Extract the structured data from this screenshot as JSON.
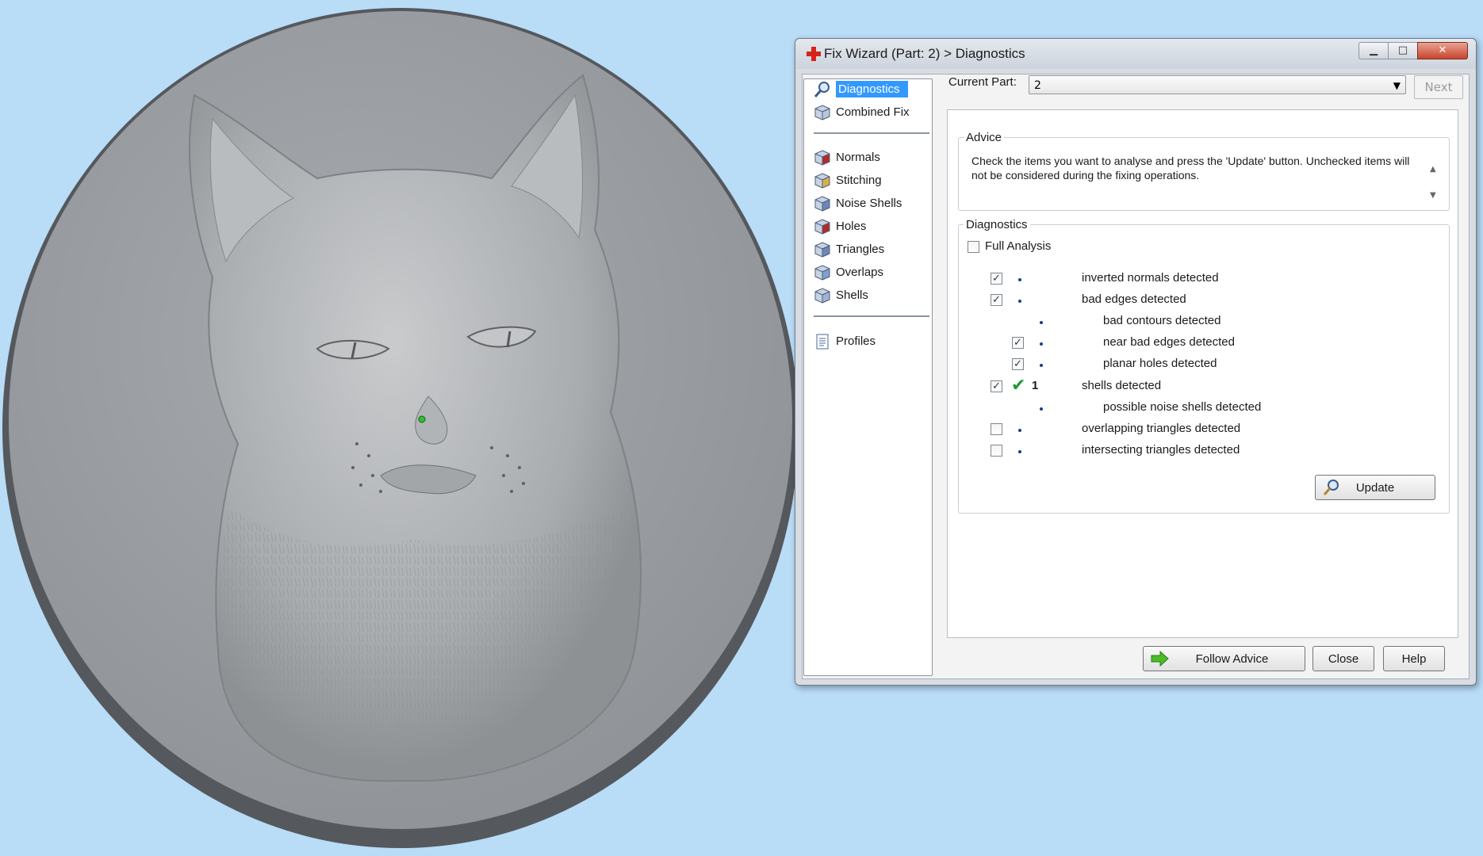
{
  "dialog": {
    "title": "Fix Wizard (Part: 2) > Diagnostics",
    "window_buttons": {
      "minimize": "▁",
      "maximize": "□",
      "close": "✕"
    }
  },
  "sidebar": {
    "items": [
      {
        "label": "Diagnostics",
        "icon": "magnifier-icon",
        "selected": true
      },
      {
        "label": "Combined Fix",
        "icon": "combined-fix-icon"
      },
      {
        "label": "Normals",
        "icon": "normals-cube-icon"
      },
      {
        "label": "Stitching",
        "icon": "stitching-cube-icon"
      },
      {
        "label": "Noise Shells",
        "icon": "noise-shells-icon"
      },
      {
        "label": "Holes",
        "icon": "holes-cube-icon"
      },
      {
        "label": "Triangles",
        "icon": "triangles-cube-icon"
      },
      {
        "label": "Overlaps",
        "icon": "overlaps-cube-icon"
      },
      {
        "label": "Shells",
        "icon": "shells-cube-icon"
      },
      {
        "label": "Profiles",
        "icon": "profiles-document-icon"
      }
    ]
  },
  "part": {
    "label": "Current Part:",
    "value": "2",
    "next_label": "Next"
  },
  "advice": {
    "legend": "Advice",
    "text": "Check the items you want to analyse and press the 'Update' button. Unchecked items will not be considered during the fixing operations."
  },
  "diagnostics": {
    "legend": "Diagnostics",
    "full_analysis": {
      "label": "Full Analysis",
      "checked": false
    },
    "rows": [
      {
        "label": "inverted normals detected",
        "checked": true,
        "indent": 0,
        "has_checkbox": true,
        "count": ""
      },
      {
        "label": "bad edges detected",
        "checked": true,
        "indent": 0,
        "has_checkbox": true,
        "count": ""
      },
      {
        "label": "bad contours detected",
        "checked": false,
        "indent": 1,
        "has_checkbox": false,
        "count": ""
      },
      {
        "label": "near bad edges detected",
        "checked": true,
        "indent": 1,
        "has_checkbox": true,
        "count": ""
      },
      {
        "label": "planar holes detected",
        "checked": true,
        "indent": 1,
        "has_checkbox": true,
        "count": ""
      },
      {
        "label": "shells detected",
        "checked": true,
        "indent": 0,
        "has_checkbox": true,
        "count": "1",
        "ok": true
      },
      {
        "label": "possible noise shells detected",
        "checked": false,
        "indent": 1,
        "has_checkbox": false,
        "count": ""
      },
      {
        "label": "overlapping triangles detected",
        "checked": false,
        "indent": 0,
        "has_checkbox": true,
        "count": ""
      },
      {
        "label": "intersecting triangles detected",
        "checked": false,
        "indent": 0,
        "has_checkbox": true,
        "count": ""
      }
    ],
    "update_label": "Update"
  },
  "footer": {
    "follow_advice_label": "Follow Advice",
    "close_label": "Close",
    "help_label": "Help"
  },
  "colors": {
    "background": "#b9dcf7",
    "model_gray": "#9a9da1",
    "selection_blue": "#3399ff",
    "check_green": "#1e9c3a"
  }
}
